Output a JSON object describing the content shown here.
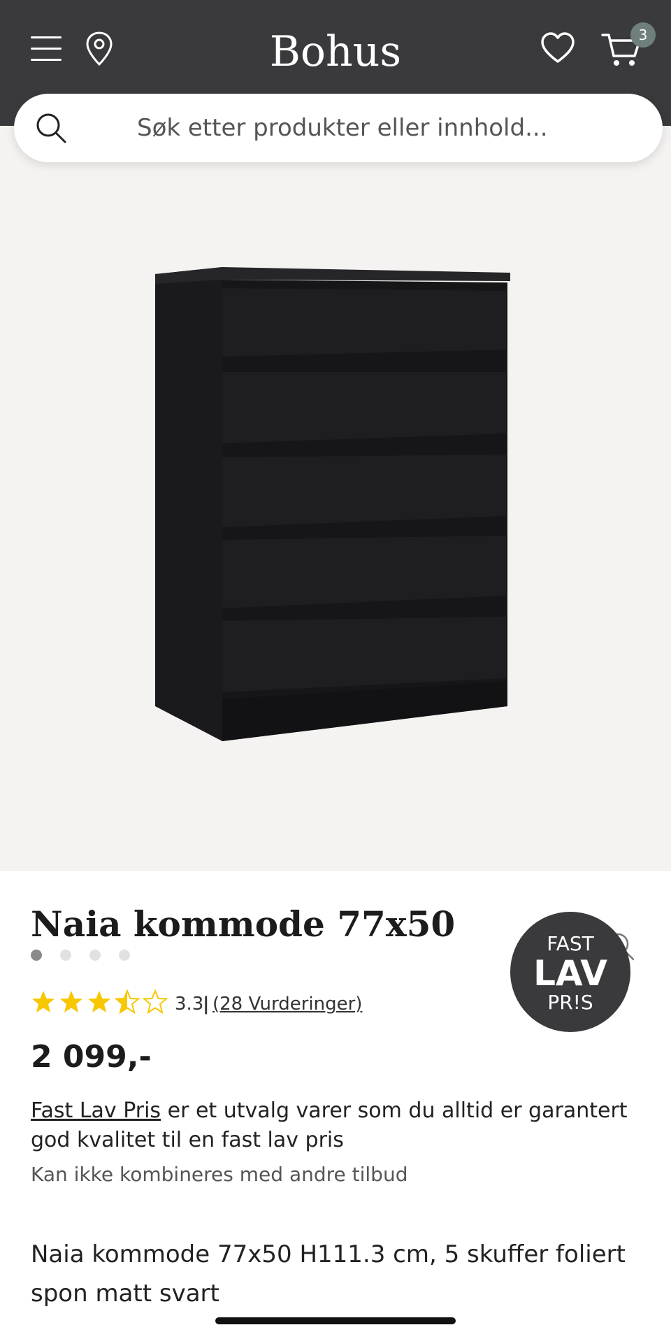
{
  "header": {
    "logo": "Bohus",
    "cart_count": "3",
    "background_color": "#3a3a3d",
    "icons": [
      "menu-icon",
      "location-pin-icon",
      "heart-icon",
      "cart-icon"
    ]
  },
  "search": {
    "placeholder": "Søk etter produkter eller innhold..."
  },
  "gallery": {
    "image_description": "black chest of drawers with 5 drawers",
    "slide_count": 4,
    "active_slide": 1
  },
  "product": {
    "title": "Naia kommode 77x50",
    "rating": {
      "value": "3.3",
      "stars_filled": 3.5,
      "stars_total": 5,
      "separator": "|",
      "reviews_label": "(28 Vurderinger)"
    },
    "price": "2 099,-",
    "badge": {
      "line1": "FAST",
      "line2": "LAV",
      "line3": "PR!S"
    },
    "fast_lav_pris": {
      "link": "Fast Lav Pris",
      "text": " er et utvalg varer som du alltid er garantert god kvalitet til en fast lav pris",
      "note": "Kan ikke kombineres med andre tilbud"
    },
    "description": "Naia kommode 77x50 H111.3 cm, 5 skuffer foliert spon matt svart"
  },
  "colors": {
    "star": "#f7c700",
    "header": "#3a3a3d",
    "gallery_bg": "#f5f3f1",
    "badge": "#6f7f7b"
  }
}
